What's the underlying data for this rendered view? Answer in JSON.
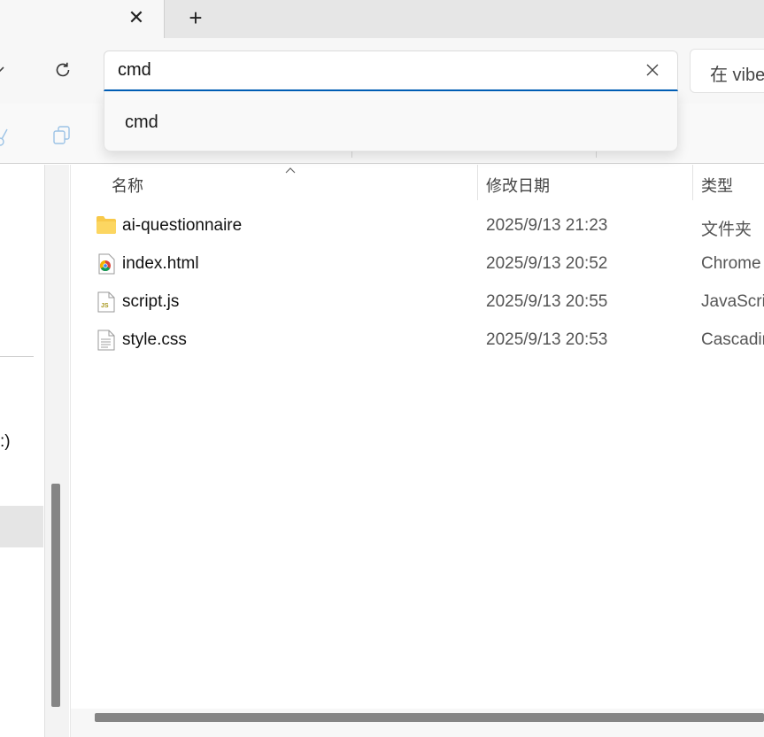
{
  "tabs": {
    "close_glyph": "✕",
    "new_tab_glyph": "+"
  },
  "address_bar": {
    "value": "cmd",
    "clear_glyph": "✕"
  },
  "search_box": {
    "text": "在 vibe"
  },
  "suggestions": [
    {
      "label": "cmd"
    }
  ],
  "nav_pane": {
    "drive_label_fragment": ":)"
  },
  "columns": {
    "name": "名称",
    "date_modified": "修改日期",
    "type": "类型"
  },
  "files": [
    {
      "name": "ai-questionnaire",
      "date": "2025/9/13 21:23",
      "type": "文件夹",
      "icon": "folder-icon"
    },
    {
      "name": "index.html",
      "date": "2025/9/13 20:52",
      "type": "Chrome",
      "icon": "chrome-html-icon"
    },
    {
      "name": "script.js",
      "date": "2025/9/13 20:55",
      "type": "JavaScrip",
      "icon": "js-file-icon"
    },
    {
      "name": "style.css",
      "date": "2025/9/13 20:53",
      "type": "Cascadin",
      "icon": "css-file-icon"
    }
  ],
  "colors": {
    "accent": "#005fb8",
    "folder": "#f8c94a",
    "scroll_thumb": "#858585"
  }
}
